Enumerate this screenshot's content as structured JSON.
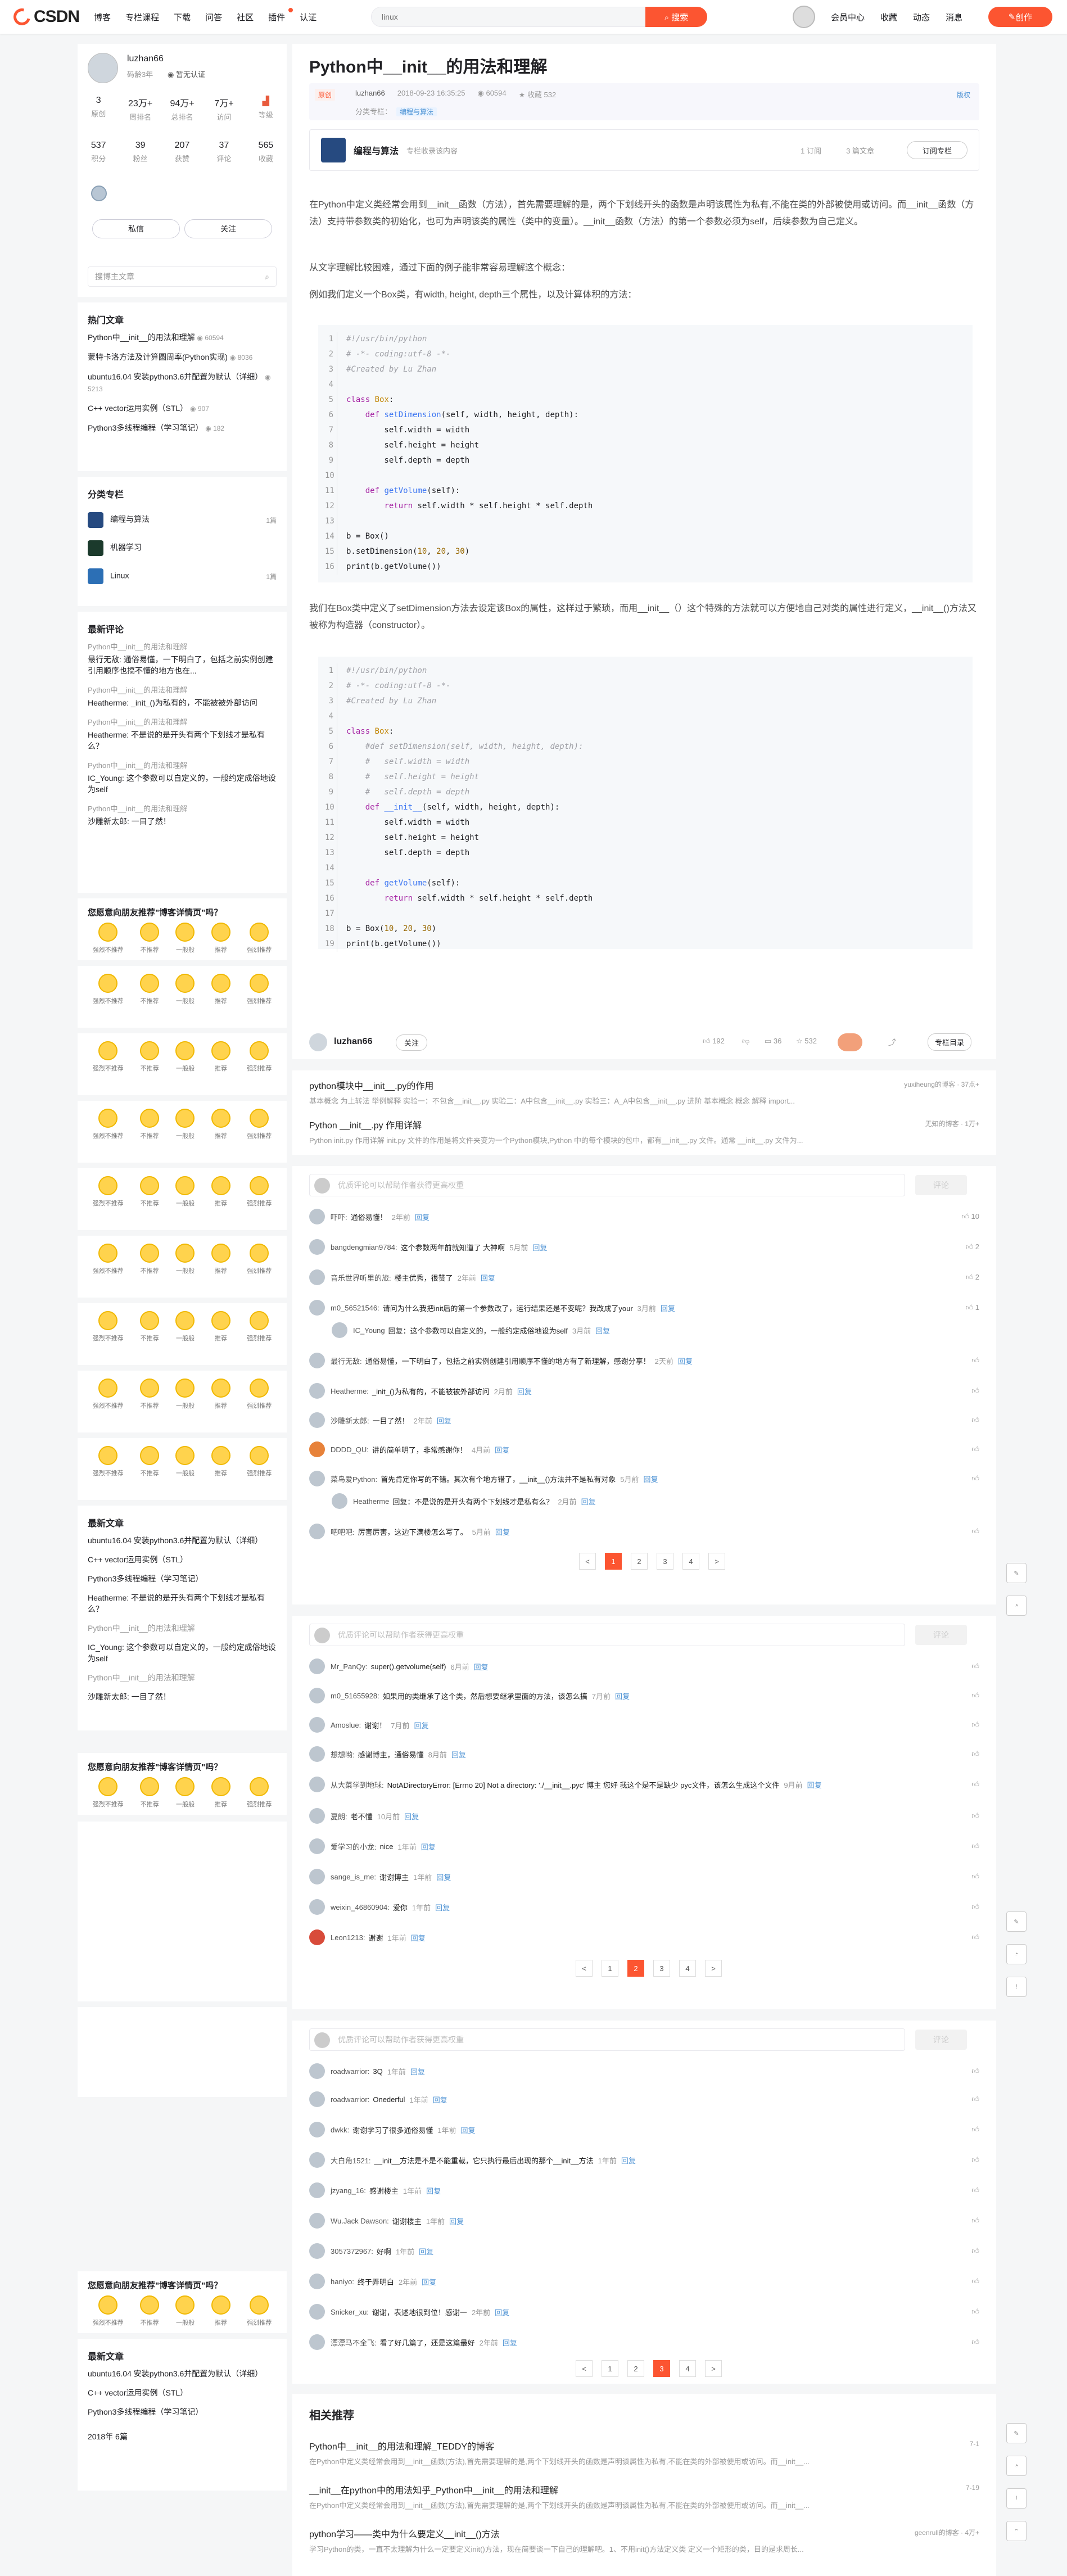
{
  "nav": {
    "logo": "CSDN",
    "links": [
      "博客",
      "专栏课程",
      "下载",
      "问答",
      "社区",
      "插件",
      "认证"
    ],
    "search_placeholder": "linux",
    "search_btn": "搜索",
    "right": [
      "会员中心",
      "收藏",
      "动态",
      "消息"
    ],
    "create": "创作"
  },
  "profile": {
    "name": "luzhan66",
    "code": "码龄3年",
    "cert": "暂无认证",
    "stats1": [
      {
        "v": "3",
        "l": "原创"
      },
      {
        "v": "23万+",
        "l": "周排名"
      },
      {
        "v": "94万+",
        "l": "总排名"
      },
      {
        "v": "7万+",
        "l": "访问"
      },
      {
        "v": "",
        "l": "等级"
      }
    ],
    "stats2": [
      {
        "v": "537",
        "l": "积分"
      },
      {
        "v": "39",
        "l": "粉丝"
      },
      {
        "v": "207",
        "l": "获赞"
      },
      {
        "v": "37",
        "l": "评论"
      },
      {
        "v": "565",
        "l": "收藏"
      }
    ],
    "btn1": "私信",
    "btn2": "关注"
  },
  "sidesearch": "搜博主文章",
  "hot": {
    "title": "热门文章",
    "items": [
      {
        "t": "Python中__init__的用法和理解",
        "m": "60594"
      },
      {
        "t": "蒙特卡洛方法及计算圆周率(Python实现)",
        "m": "8036"
      },
      {
        "t": "ubuntu16.04 安装python3.6并配置为默认（详细）",
        "m": "5213"
      },
      {
        "t": "C++ vector运用实例（STL）",
        "m": "907"
      },
      {
        "t": "Python3多线程编程（学习笔记）",
        "m": "182"
      }
    ]
  },
  "cats": {
    "title": "分类专栏",
    "items": [
      {
        "n": "编程与算法",
        "c": "1篇"
      },
      {
        "n": "机器学习",
        "c": ""
      },
      {
        "n": "Linux",
        "c": "1篇"
      }
    ]
  },
  "recent": {
    "title": "最新评论",
    "items": [
      {
        "q": "Python中__init__的用法和理解",
        "c": "最行无敌: 通俗易懂，一下明白了，包括之前实例创建引用顺序也搞不懂的地方也在..."
      },
      {
        "q": "Python中__init__的用法和理解",
        "c": "Heatherme: _init_()为私有的，不能被被外部访问"
      },
      {
        "q": "Python中__init__的用法和理解",
        "c": "Heatherme: 不是说的是开头有两个下划线才是私有么？"
      },
      {
        "q": "Python中__init__的用法和理解",
        "c": "IC_Young: 这个参数可以自定义的，一般约定成俗地设为self"
      },
      {
        "q": "Python中__init__的用法和理解",
        "c": "沙雕新太郎: 一目了然！"
      }
    ]
  },
  "vote": {
    "title": "您愿意向朋友推荐\"博客详情页\"吗？",
    "opts": [
      "强烈不推荐",
      "不推荐",
      "一般般",
      "推荐",
      "强烈推荐"
    ]
  },
  "latest": {
    "title": "最新文章",
    "items": [
      "ubuntu16.04 安装python3.6并配置为默认（详细）",
      "C++ vector运用实例（STL）",
      "Python3多线程编程（学习笔记）"
    ]
  },
  "latest_side": {
    "items": [
      "Heatherme: 不是说的是开头有两个下划线才是私有么？",
      "Python中__init__的用法和理解",
      "IC_Young: 这个参数可以自定义的，一般约定成俗地设为self",
      "Python中__init__的用法和理解",
      "沙雕新太郎: 一目了然！"
    ]
  },
  "archive": "2018年 6篇",
  "article": {
    "title": "Python中__init__的用法和理解",
    "orig": "原创",
    "author": "luzhan66",
    "date": "2018-09-23 16:35:25",
    "views": "60594",
    "fav": "收藏 532",
    "category_label": "分类专栏：",
    "category": "编程与算法",
    "edit": "版权",
    "col_name": "编程与算法",
    "col_desc": "专栏收录该内容",
    "col_stat1": "1 订阅",
    "col_stat2": "3 篇文章",
    "col_btn": "订阅专栏",
    "p1": "在Python中定义类经常会用到__init__函数（方法），首先需要理解的是，两个下划线开头的函数是声明该属性为私有,不能在类的外部被使用或访问。而__init__函数（方法）支持带参数类的初始化，也可为声明该类的属性（类中的变量）。__init__函数（方法）的第一个参数必须为self，后续参数为自己定义。",
    "p2": "从文字理解比较困难，通过下面的例子能非常容易理解这个概念：",
    "p3": "例如我们定义一个Box类，有width, height, depth三个属性，以及计算体积的方法：",
    "p4": "我们在Box类中定义了setDimension方法去设定该Box的属性，这样过于繁琐，而用__init__（）这个特殊的方法就可以方便地自己对类的属性进行定义，__init__()方法又被称为构造器（constructor）。"
  },
  "authorbar": {
    "name": "luzhan66",
    "follow": "关注",
    "likes": "192",
    "dislike": "",
    "coins": "36",
    "fav": "532",
    "catalog": "专栏目录"
  },
  "recs": [
    {
      "t": "python模块中__init__.py的作用",
      "src": "yuxiheung的博客  · 37点+",
      "d": "基本概念 为上转法 举例解释 实验一：不包含__init__.py 实验二：A中包含__init__.py 实验三：A_A中包含__init__.py 进阶 基本概念 概念 解释 import..."
    },
    {
      "t": "Python __init__.py 作用详解",
      "src": "无知的博客  · 1万+",
      "d": "Python init.py 作用详解 init.py 文件的作用是将文件夹变为一个Python模块,Python 中的每个模块的包中，都有__init__.py 文件。通常 __init__.py 文件为..."
    }
  ],
  "comments1": {
    "placeholder": "优质评论可以帮助作者获得更高权重",
    "send": "评论",
    "rows": [
      {
        "n": "吓吓:",
        "t": "通俗易懂！",
        "tm": "2年前",
        "l": "10"
      },
      {
        "n": "bangdengmian9784:",
        "t": "这个参数两年前就知道了 大神啊",
        "tm": "5月前",
        "l": "2"
      },
      {
        "n": "音乐世界听里的旅:",
        "t": "楼主优秀，很赞了",
        "tm": "2年前",
        "l": "2"
      },
      {
        "n": "m0_56521546:",
        "t": "请问为什么我把init后的第一个参数改了，运行结果还是不变呢？我改成了your",
        "tm": "3月前",
        "l": "1"
      },
      {
        "n": "IC_Young",
        "t": "回复：这个参数可以自定义的，一般约定成俗地设为self",
        "tm": "3月前",
        "l": ""
      },
      {
        "n": "最行无敌:",
        "t": "通俗易懂，一下明白了，包括之前实例创建引用顺序不懂的地方有了新理解，感谢分享！",
        "tm": "2天前",
        "l": ""
      },
      {
        "n": "Heatherme:",
        "t": "_init_()为私有的，不能被被外部访问",
        "tm": "2月前",
        "l": ""
      },
      {
        "n": "沙雕新太郎:",
        "t": "一目了然！",
        "tm": "2年前",
        "l": ""
      },
      {
        "n": "DDDD_QU:",
        "t": "讲的简单明了，非常感谢你！",
        "tm": "4月前",
        "l": ""
      },
      {
        "n": "菜鸟爱Python:",
        "t": "首先肯定你写的不错。其次有个地方错了，__init__()方法并不是私有对象",
        "tm": "5月前",
        "l": ""
      },
      {
        "n": "Heatherme",
        "t": "回复：不是说的是开头有两个下划线才是私有么？",
        "tm": "2月前",
        "l": ""
      },
      {
        "n": "吧吧吧:",
        "t": "厉害厉害，这边下满楼怎么写了。",
        "tm": "5月前",
        "l": ""
      }
    ]
  },
  "comments2": {
    "placeholder": "优质评论可以帮助作者获得更高权重",
    "send": "评论",
    "rows": [
      {
        "n": "Mr_PanQy:",
        "t": "super().getvolume(self)",
        "tm": "6月前"
      },
      {
        "n": "m0_51655928:",
        "t": "如果用的类继承了这个类，然后想要继承里面的方法，该怎么搞",
        "tm": "7月前"
      },
      {
        "n": "Amoslue:",
        "t": "谢谢！",
        "tm": "7月前"
      },
      {
        "n": "想想哟:",
        "t": "感谢博主，通俗易懂",
        "tm": "8月前"
      },
      {
        "n": "从大菜学到地球:",
        "t": "NotADirectoryError: [Errno 20] Not a directory: './__init__.pyc' 博主 您好 我这个是不是缺少 pyc文件，该怎么生成这个文件",
        "tm": "9月前"
      },
      {
        "n": "夏朗:",
        "t": "老不懂",
        "tm": "10月前"
      },
      {
        "n": "爱学习的小龙:",
        "t": "nice",
        "tm": "1年前"
      },
      {
        "n": "sange_is_me:",
        "t": "谢谢博主",
        "tm": "1年前"
      },
      {
        "n": "weixin_46860904:",
        "t": "爱你",
        "tm": "1年前"
      },
      {
        "n": "Leon1213:",
        "t": "谢谢",
        "tm": "1年前"
      }
    ]
  },
  "comments3": {
    "placeholder": "优质评论可以帮助作者获得更高权重",
    "send": "评论",
    "rows": [
      {
        "n": "roadwarrior:",
        "t": "3Q",
        "tm": "1年前"
      },
      {
        "n": "roadwarrior:",
        "t": "Onederful",
        "tm": "1年前"
      },
      {
        "n": "dwkk:",
        "t": "谢谢学习了很多通俗易懂",
        "tm": "1年前"
      },
      {
        "n": "大白角1521:",
        "t": "__init__方法是不是不能重载，它只执行最后出现的那个__init__方法",
        "tm": "1年前"
      },
      {
        "n": "jzyang_16:",
        "t": "感谢楼主",
        "tm": "1年前"
      },
      {
        "n": "Wu.Jack Dawson:",
        "t": "谢谢楼主",
        "tm": "1年前"
      },
      {
        "n": "3057372967:",
        "t": "好啊",
        "tm": "1年前"
      },
      {
        "n": "haniyo:",
        "t": "终于弄明白",
        "tm": "2年前"
      },
      {
        "n": "Snicker_xu:",
        "t": "谢谢，表述地很到位！感谢一",
        "tm": "2年前"
      },
      {
        "n": "漂漂马不全飞:",
        "t": "看了好几篇了，还是这篇最好",
        "tm": "2年前"
      }
    ]
  },
  "pager1": [
    "<",
    "1",
    "2",
    "3",
    "4",
    ">"
  ],
  "related": {
    "title": "相关推荐",
    "items": [
      {
        "t": "Python中__init__的用法和理解_TEDDY的博客",
        "src": "7-1",
        "d": "在Python中定义类经常会用到__init__函数(方法),首先需要理解的是,两个下划线开头的函数是声明该属性为私有,不能在类的外部被使用或访问。而__init__..."
      },
      {
        "t": "__init__在python中的用法知乎_Python中__init__的用法和理解",
        "src": "7-19",
        "d": "在Python中定义类经常会用到__init__函数(方法),首先需要理解的是,两个下划线开头的函数是声明该属性为私有,不能在类的外部被使用或访问。而__init__..."
      },
      {
        "t": "python学习——类中为什么要定义__init__()方法",
        "src": "geenrull的博客 · 4万+",
        "d": "学习Python的类，一直不太理解为什么一定要定义init()方法，现在简要谈一下自己的理解吧。1、不用init()方法定义类 定义一个矩形的类，目的是求周长..."
      }
    ]
  },
  "tools": [
    "",
    "",
    "",
    "",
    "",
    "",
    "",
    "",
    ""
  ]
}
